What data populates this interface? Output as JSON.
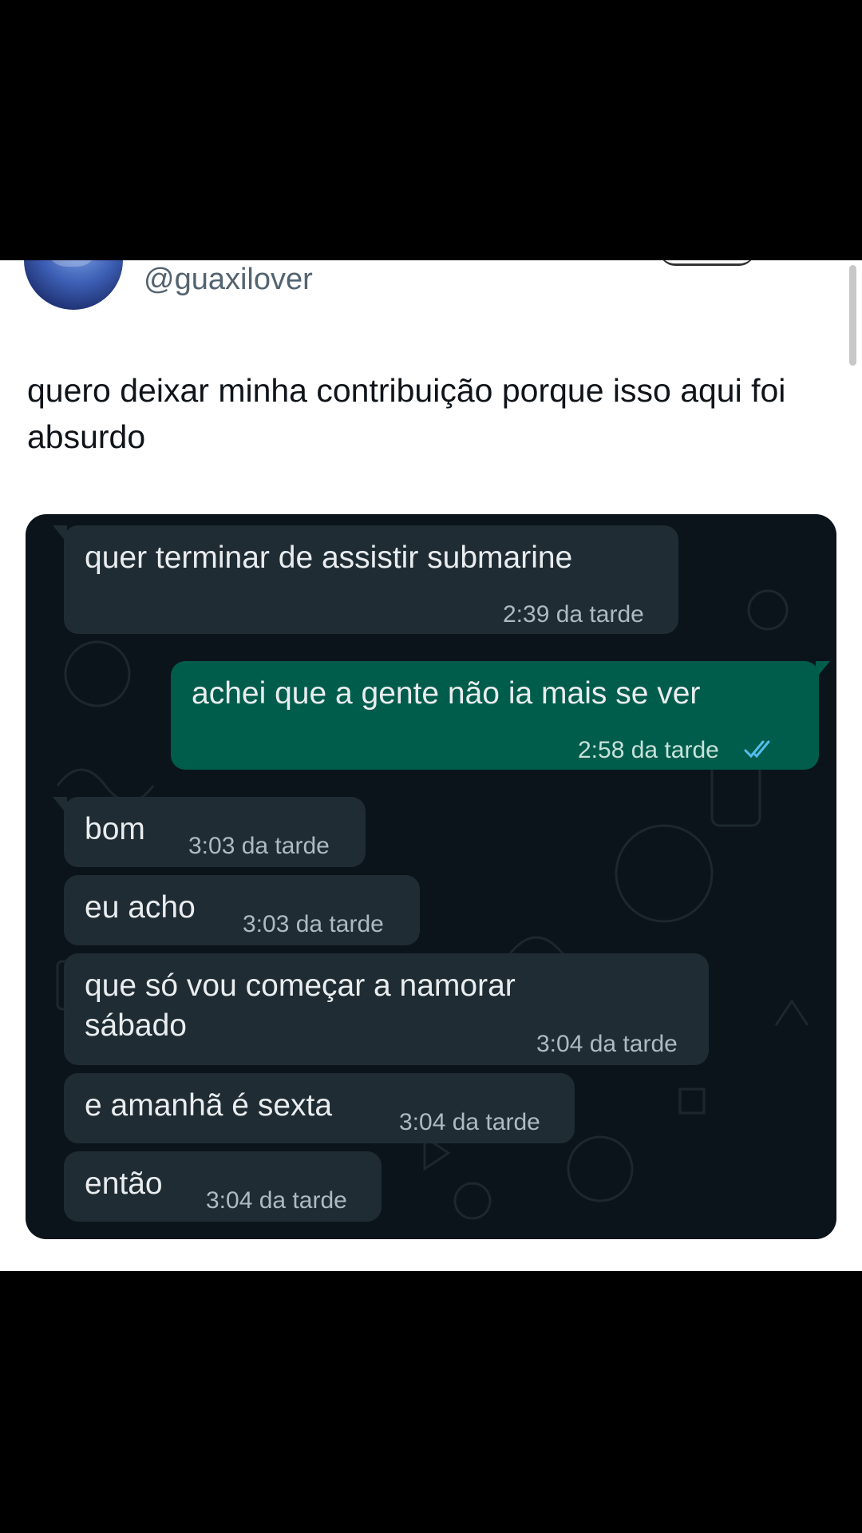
{
  "tweet": {
    "handle": "@guaxilover",
    "text": "quero deixar minha contribuição porque isso aqui foi absurdo"
  },
  "chat": {
    "messages": [
      {
        "direction": "incoming",
        "text": "quer terminar de assistir submarine",
        "time": "2:39 da tarde"
      },
      {
        "direction": "outgoing",
        "text": "achei que a gente não ia mais se ver",
        "time": "2:58 da tarde",
        "status_icon": "double-check-icon"
      },
      {
        "direction": "incoming",
        "text": "bom",
        "time": "3:03 da tarde"
      },
      {
        "direction": "incoming",
        "text": "eu acho",
        "time": "3:03 da tarde"
      },
      {
        "direction": "incoming",
        "text": "que só vou começar a namorar\nsábado",
        "time": "3:04 da tarde"
      },
      {
        "direction": "incoming",
        "text": "e amanhã é sexta",
        "time": "3:04 da tarde"
      },
      {
        "direction": "incoming",
        "text": "então",
        "time": "3:04 da tarde"
      }
    ]
  },
  "colors": {
    "incoming_bubble": "#202c33",
    "outgoing_bubble": "#005c4b",
    "chat_background": "#0b141a",
    "read_receipt": "#53bdeb"
  }
}
